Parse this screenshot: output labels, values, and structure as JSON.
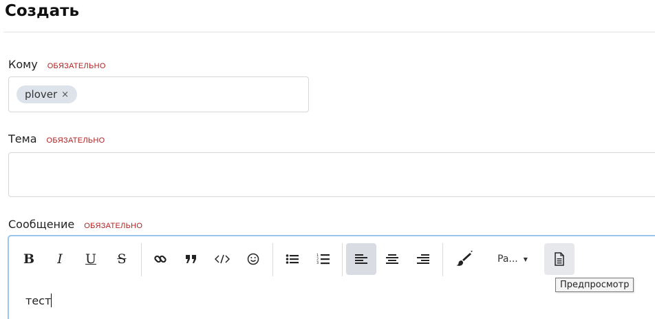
{
  "page": {
    "title": "Создать"
  },
  "form": {
    "required_text": "ОБЯЗАТЕЛЬНО",
    "to": {
      "label": "Кому",
      "chips": [
        {
          "label": "plover",
          "remove": "×"
        }
      ]
    },
    "subject": {
      "label": "Тема",
      "value": ""
    },
    "message": {
      "label": "Сообщение",
      "content": "тест"
    }
  },
  "toolbar": {
    "bold": "B",
    "italic": "I",
    "underline": "U",
    "strike": "S",
    "paragraph_select": "Pa...",
    "buttons": [
      {
        "name": "bold",
        "icon": "bold-icon"
      },
      {
        "name": "italic",
        "icon": "italic-icon"
      },
      {
        "name": "underline",
        "icon": "underline-icon"
      },
      {
        "name": "strikethrough",
        "icon": "strikethrough-icon"
      },
      {
        "name": "link",
        "icon": "link-icon"
      },
      {
        "name": "quote",
        "icon": "quote-icon"
      },
      {
        "name": "code",
        "icon": "code-icon"
      },
      {
        "name": "emoji",
        "icon": "emoji-icon"
      },
      {
        "name": "bullet-list",
        "icon": "bullet-list-icon"
      },
      {
        "name": "numbered-list",
        "icon": "numbered-list-icon"
      },
      {
        "name": "align-left",
        "icon": "align-left-icon",
        "active": true
      },
      {
        "name": "align-center",
        "icon": "align-center-icon"
      },
      {
        "name": "align-right",
        "icon": "align-right-icon"
      },
      {
        "name": "text-color",
        "icon": "paintbrush-icon"
      },
      {
        "name": "preview",
        "icon": "document-icon"
      }
    ]
  },
  "tooltip": {
    "text": "Предпросмотр"
  },
  "colors": {
    "required": "#b02020",
    "focus_border": "#9cc4ee",
    "chip_bg": "#dde3ea",
    "active_bg": "#d9dde3"
  }
}
